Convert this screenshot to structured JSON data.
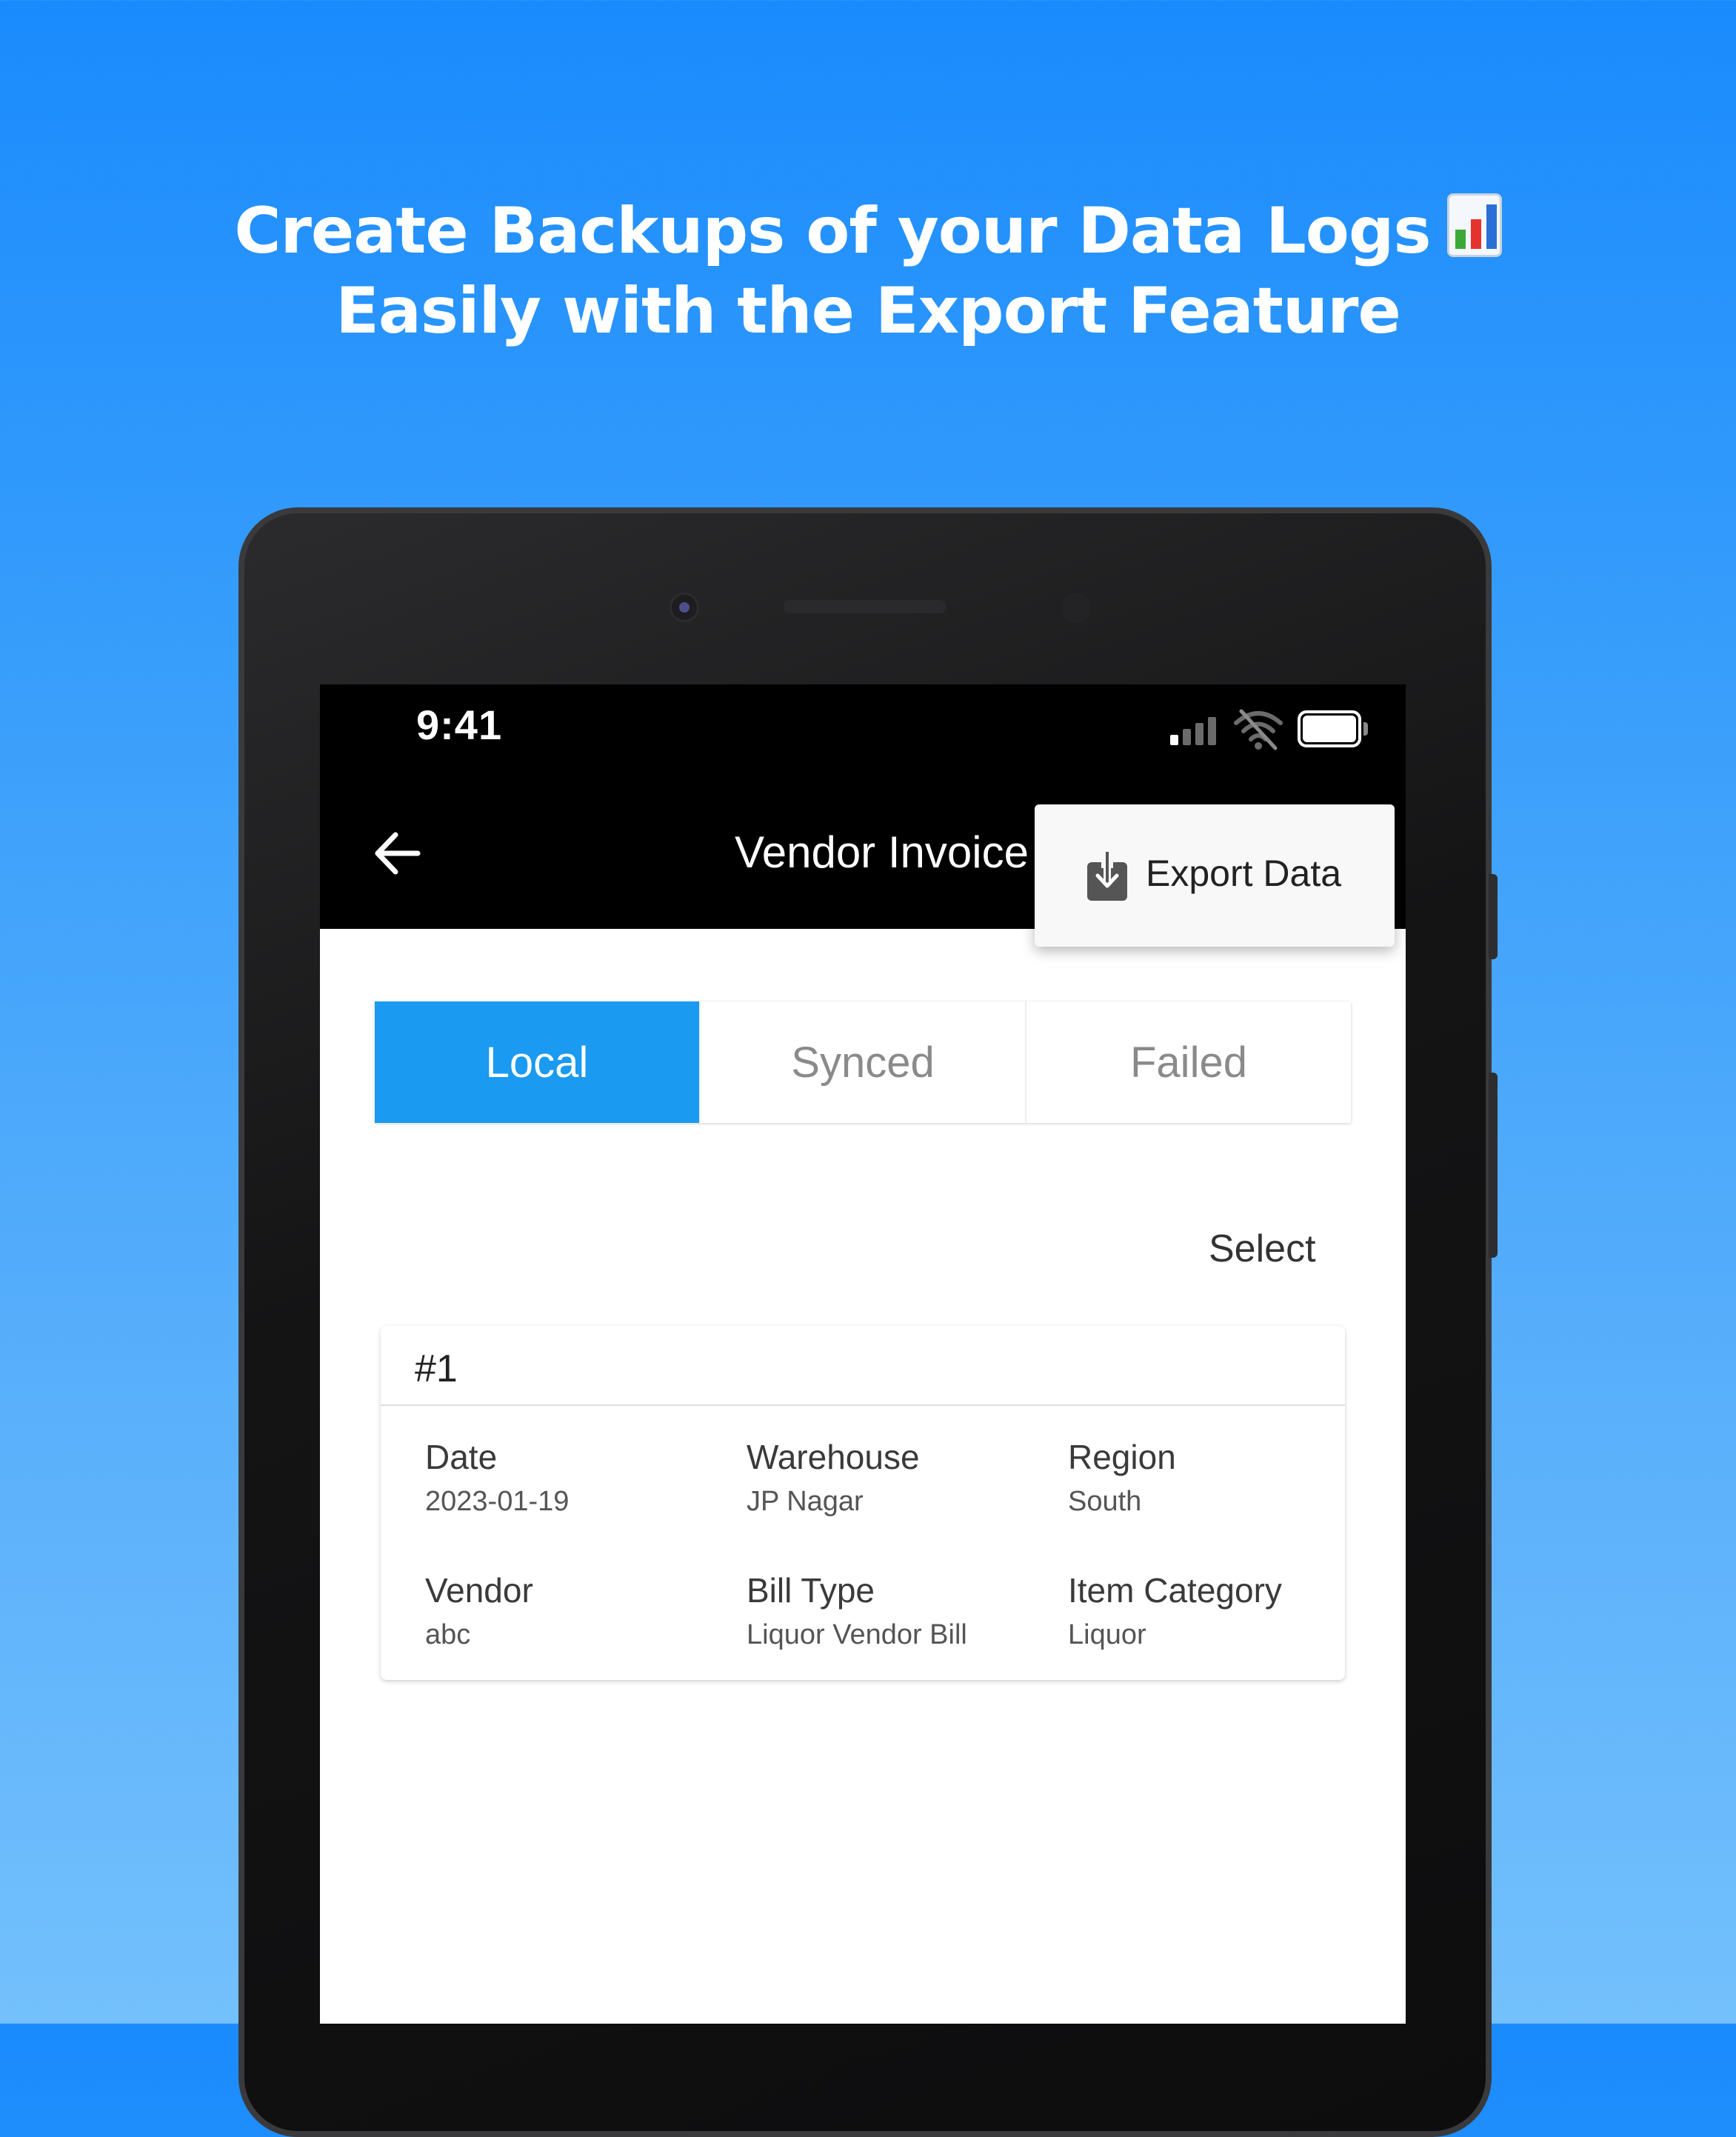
{
  "headline": {
    "line1": "Create Backups of your Data Logs",
    "line2": "Easily with the Export Feature",
    "emoji_icon": "bar-chart-icon"
  },
  "status_bar": {
    "time": "9:41",
    "icons": [
      "cellular-signal-icon",
      "wifi-off-icon",
      "battery-icon"
    ]
  },
  "app_bar": {
    "title": "Vendor Invoice",
    "back_icon": "back-arrow-icon"
  },
  "export_menu": {
    "label": "Export Data",
    "icon": "download-icon"
  },
  "tabs": [
    {
      "label": "Local",
      "active": true
    },
    {
      "label": "Synced",
      "active": false
    },
    {
      "label": "Failed",
      "active": false
    }
  ],
  "select_label": "Select",
  "colors": {
    "accent": "#1a9af0",
    "app_bar": "#000000",
    "background_top": "#1a8bfd",
    "background_bottom": "#73c0fc"
  },
  "records": [
    {
      "id": "#1",
      "fields": [
        {
          "label": "Date",
          "value": "2023-01-19"
        },
        {
          "label": "Warehouse",
          "value": "JP Nagar"
        },
        {
          "label": "Region",
          "value": "South"
        },
        {
          "label": "Vendor",
          "value": "abc"
        },
        {
          "label": "Bill Type",
          "value": "Liquor Vendor Bill"
        },
        {
          "label": "Item Category",
          "value": "Liquor"
        }
      ]
    }
  ]
}
